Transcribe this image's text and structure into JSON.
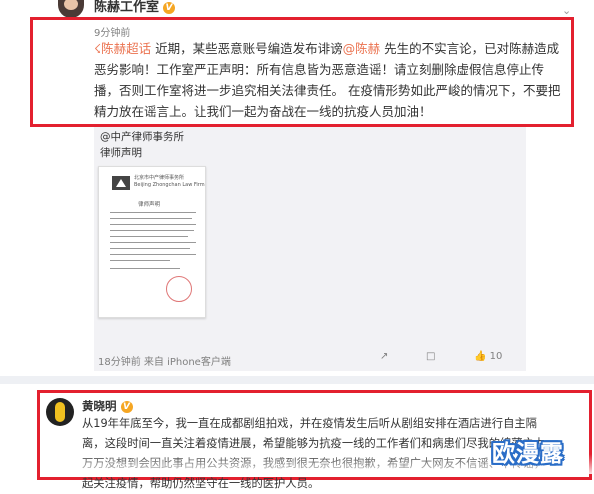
{
  "post1": {
    "author": "陈赫工作室",
    "time": "9分钟前",
    "link1": "陈赫超话",
    "text1": " 近期，某些恶意账号编造发布诽谤",
    "link2": "@陈赫",
    "text2": " 先生的不实言论，已对陈赫造成恶劣影响！工作室严正声明：所有信息皆为恶意造谣！请立刻删除虚假信息停止传播，否则工作室将进一步追究相关法律责任。 在疫情形势如此严峻的情况下，不要把精力放在谣言上。让我们一起为奋战在一线的抗疫人员加油！"
  },
  "quote": {
    "source": "@中产律师事务所",
    "subtitle": "律师声明",
    "doc_header_cn": "北京市中产律师事务所",
    "doc_header_en": "Beijing Zhongchan Law Firm",
    "doc_title": "律师声明",
    "meta": "18分钟前 来自 iPhone客户端",
    "likes": "10"
  },
  "post2": {
    "author": "黄晓明",
    "text": "从19年年底至今，我一直在成都剧组拍戏，并在疫情发生后听从剧组安排在酒店进行自主隔离，这段时间一直关注着疫情进展，希望能够为抗疫一线的工作者们和病患们尽我的绵薄之力，万万没想到会因此事占用公共资源，我感到很无奈也很抱歉，希望广大网友不信谣、不传谣，一起关注疫情，帮助仍然坚守在一线的医护人员。"
  },
  "watermark": "欧漫露",
  "colors": {
    "highlight_border": "#e3202f",
    "link": "#eb7350",
    "badge": "#f5a623"
  },
  "icons": [
    "share-icon",
    "comment-icon",
    "like-icon",
    "more-chevron-icon",
    "verified-badge-icon"
  ]
}
